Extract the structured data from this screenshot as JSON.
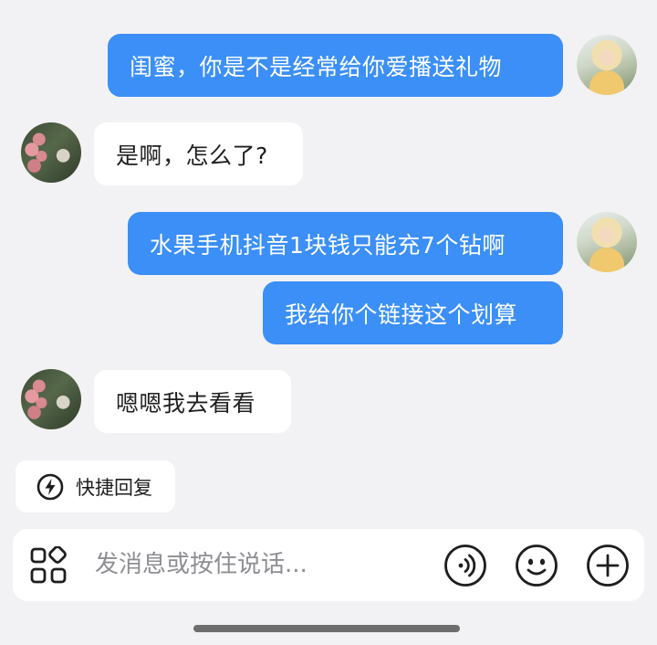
{
  "chat": {
    "messages": [
      {
        "direction": "out",
        "text": "闺蜜，你是不是经常给你爱播送礼物"
      },
      {
        "direction": "in",
        "text": "是啊，怎么了?"
      },
      {
        "direction": "out",
        "text": "水果手机抖音1块钱只能充7个钻啊"
      },
      {
        "direction": "out",
        "text": "我给你个链接这个划算"
      },
      {
        "direction": "in",
        "text": "嗯嗯我去看看"
      }
    ]
  },
  "quick_reply": {
    "label": "快捷回复",
    "icon": "lightning-bolt-icon"
  },
  "composer": {
    "placeholder": "发消息或按住说话...",
    "left_icon": "apps-grid-icon",
    "right_icons": [
      "voice-icon",
      "emoji-icon",
      "add-icon"
    ]
  },
  "colors": {
    "outgoing_bubble": "#3b8ff7",
    "incoming_bubble": "#ffffff",
    "background": "#f2f2f4"
  }
}
